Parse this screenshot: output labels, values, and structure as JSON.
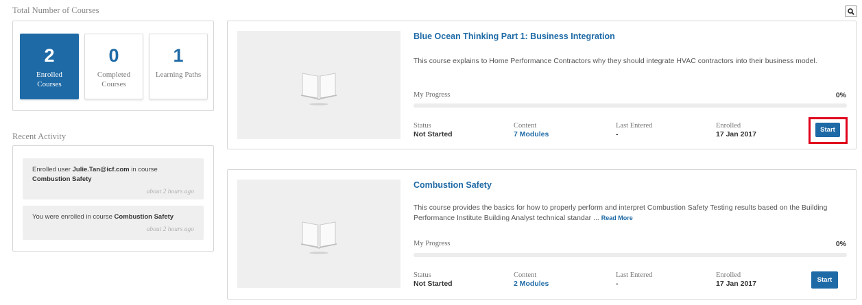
{
  "header": {
    "total_courses_title": "Total Number of Courses"
  },
  "stats": [
    {
      "value": "2",
      "label": "Enrolled Courses",
      "active": true
    },
    {
      "value": "0",
      "label": "Completed Courses",
      "active": false
    },
    {
      "value": "1",
      "label": "Learning Paths",
      "active": false
    }
  ],
  "activity": {
    "title": "Recent Activity",
    "items": [
      {
        "pre": "Enrolled user ",
        "user": "Julie.Tan@icf.com",
        "mid": " in course ",
        "course": "Combustion Safety",
        "time": "about 2 hours ago"
      },
      {
        "pre": "You were enrolled in course ",
        "course": "Combustion Safety",
        "time": "about 2 hours ago"
      }
    ]
  },
  "labels": {
    "my_progress": "My Progress",
    "status": "Status",
    "content": "Content",
    "last_entered": "Last Entered",
    "enrolled": "Enrolled",
    "start": "Start",
    "read_more": "Read More"
  },
  "courses": [
    {
      "title": "Blue Ocean Thinking Part 1: Business Integration",
      "description": "This course explains to Home Performance Contractors why they should integrate HVAC contractors into their business model.",
      "progress_text": "0%",
      "progress": 0,
      "status": "Not Started",
      "content": "7 Modules",
      "last_entered": "-",
      "enrolled": "17 Jan 2017"
    },
    {
      "title": "Combustion Safety",
      "description": "This course provides the basics for how to properly perform and interpret Combustion Safety Testing results based on the Building Performance Institute Building Analyst technical standar ... ",
      "progress_text": "0%",
      "progress": 0,
      "status": "Not Started",
      "content": "2 Modules",
      "last_entered": "-",
      "enrolled": "17 Jan 2017"
    }
  ],
  "colors": {
    "accent": "#1e6aa6",
    "highlight": "#e0001b"
  },
  "icons": {
    "search": "search-icon",
    "course_thumb": "open-book-icon"
  }
}
